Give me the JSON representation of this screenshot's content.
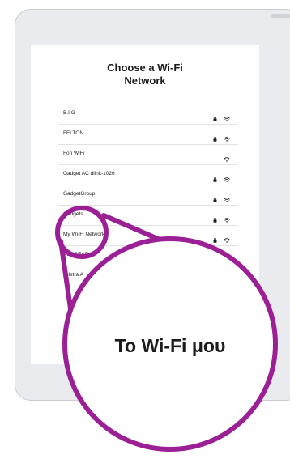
{
  "screen": {
    "title_line1": "Choose a Wi-Fi",
    "title_line2": "Network"
  },
  "networks": [
    {
      "name": "B.I.G",
      "locked": true
    },
    {
      "name": "FELTON",
      "locked": true
    },
    {
      "name": "Fon WiFi",
      "locked": false
    },
    {
      "name": "Gadget AC dlink-1026",
      "locked": true
    },
    {
      "name": "GadgetGroup",
      "locked": true
    },
    {
      "name": "Gadgets",
      "locked": true
    },
    {
      "name": "My Wi-Fi Network",
      "locked": true
    },
    {
      "name": "NETGEAR48",
      "locked": true
    },
    {
      "name": "Telstra A",
      "locked": false
    }
  ],
  "callout": {
    "text": "Το Wi-Fi μου",
    "color": "#9b2096"
  }
}
